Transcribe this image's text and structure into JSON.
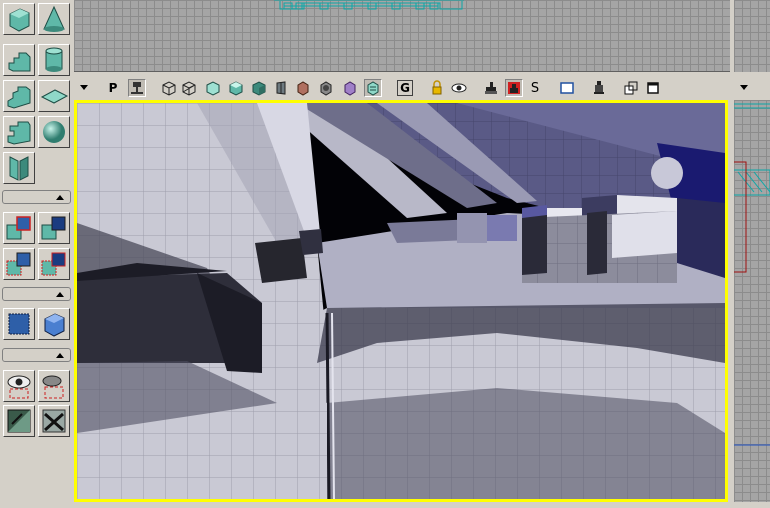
{
  "toolbox": {
    "tools": [
      {
        "name": "cube-brush-icon"
      },
      {
        "name": "cone-brush-icon"
      },
      {
        "name": "linear-stair-icon"
      },
      {
        "name": "cylinder-brush-icon"
      },
      {
        "name": "curved-stair-icon"
      },
      {
        "name": "sheet-brush-icon"
      },
      {
        "name": "spiral-stair-icon"
      },
      {
        "name": "sphere-brush-icon"
      },
      {
        "name": "volumetric-icon"
      },
      {
        "name": "csg-add-icon"
      },
      {
        "name": "csg-subtract-icon"
      },
      {
        "name": "csg-intersect-icon"
      },
      {
        "name": "csg-deintersect-icon"
      },
      {
        "name": "add-mover-icon"
      },
      {
        "name": "add-special-icon"
      },
      {
        "name": "show-selected-icon"
      },
      {
        "name": "hide-selected-icon"
      },
      {
        "name": "select-all-icon"
      },
      {
        "name": "invert-selection-icon"
      }
    ]
  },
  "viewport_toolbar": {
    "labels": {
      "p": "P",
      "g": "G",
      "s": "S"
    },
    "accent_color": "#ffff00"
  }
}
